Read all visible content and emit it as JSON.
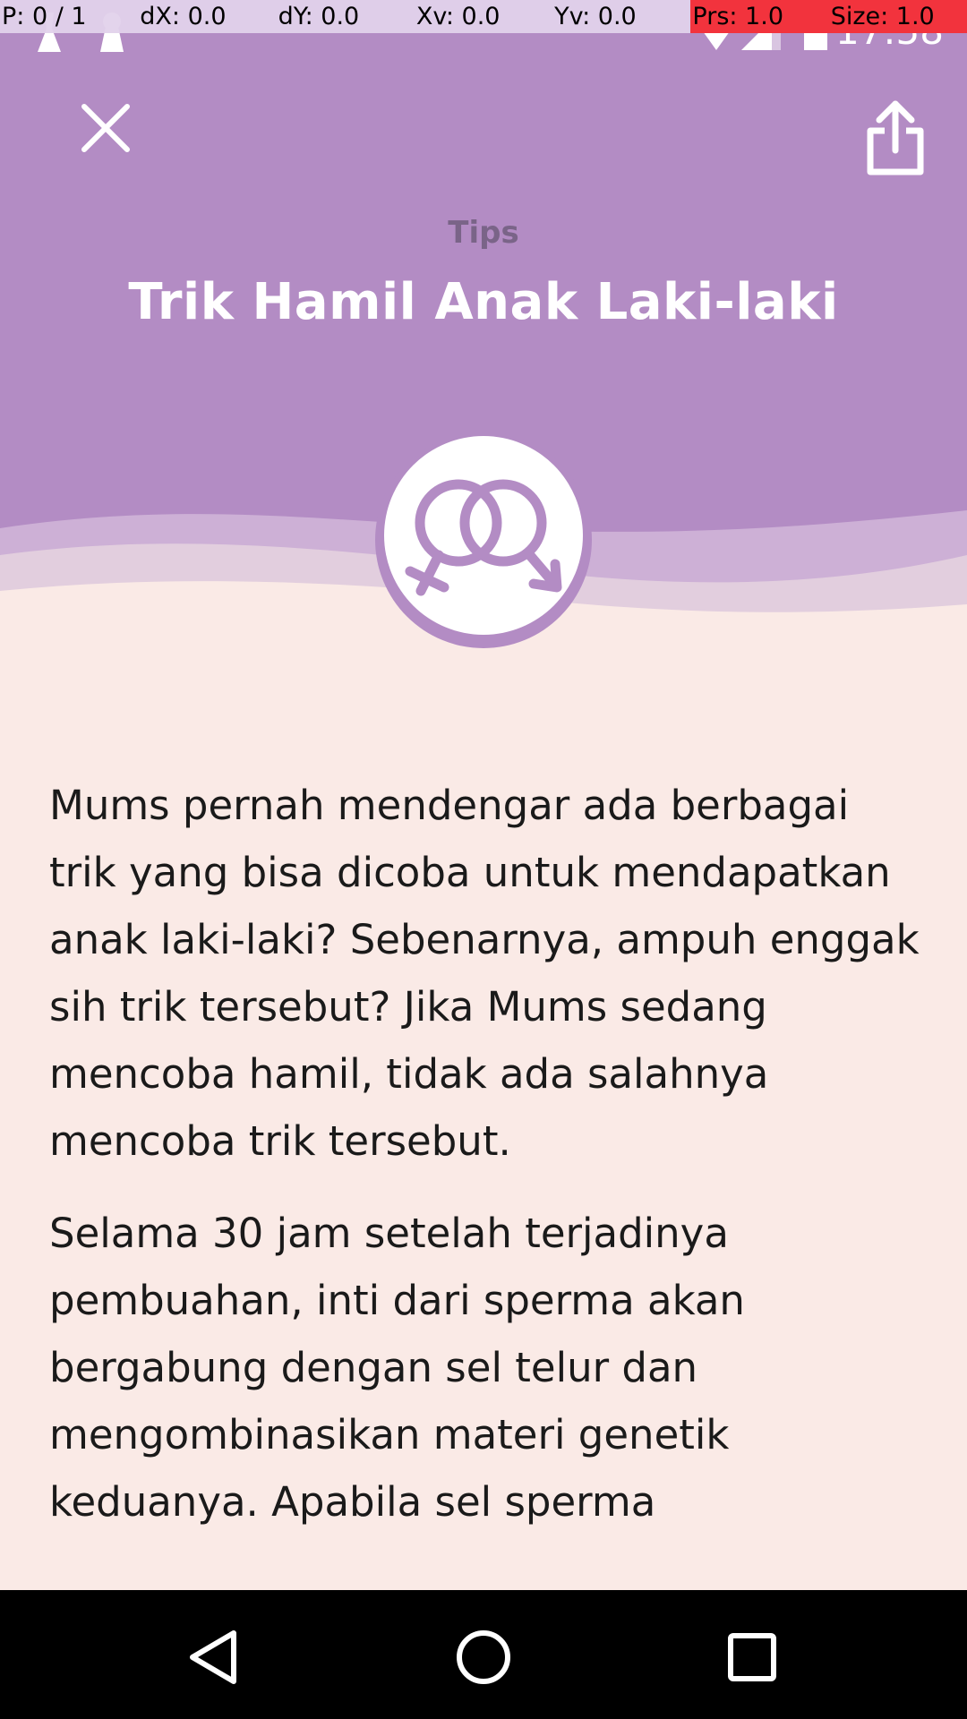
{
  "debug": {
    "pointer": "P: 0 / 1",
    "dx": "dX: 0.0",
    "dy": "dY: 0.0",
    "xv": "Xv: 0.0",
    "yv": "Yv: 0.0",
    "prs": "Prs: 1.0",
    "size": "Size: 1.0"
  },
  "status_bar": {
    "time": "17:58"
  },
  "header": {
    "category": "Tips",
    "title": "Trik Hamil Anak Laki-laki",
    "background_color": "#b38cc4"
  },
  "article": {
    "paragraphs": [
      "Mums pernah mendengar ada berbagai trik yang bisa dicoba untuk mendapatkan anak laki-laki? Sebenarnya, ampuh enggak sih trik tersebut? Jika Mums sedang mencoba hamil, tidak ada salahnya mencoba trik tersebut.",
      "Selama 30 jam setelah terjadinya pembuahan, inti dari sperma akan bergabung dengan sel telur dan mengombinasikan materi genetik keduanya. Apabila sel sperma"
    ]
  },
  "icons": {
    "close": "close-icon",
    "share": "share-icon",
    "emblem": "gender-symbols-icon",
    "back": "back-triangle-icon",
    "home": "home-circle-icon",
    "recents": "recents-square-icon"
  }
}
